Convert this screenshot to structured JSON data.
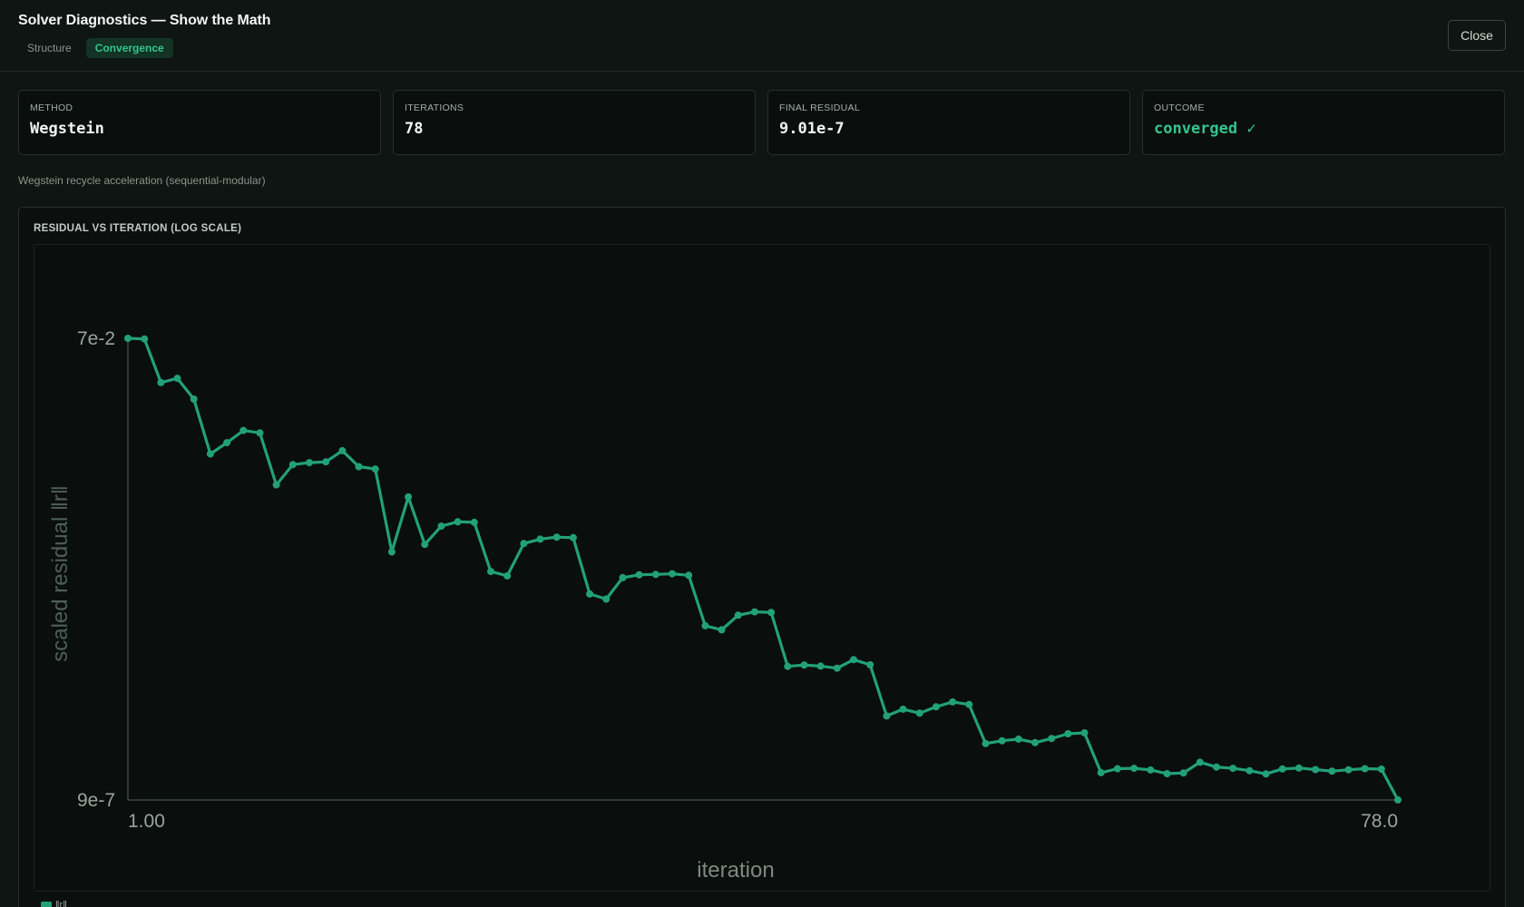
{
  "header": {
    "title": "Solver Diagnostics — Show the Math",
    "tabs": [
      {
        "label": "Structure",
        "active": false
      },
      {
        "label": "Convergence",
        "active": true
      }
    ],
    "close_label": "Close"
  },
  "stats": [
    {
      "label": "METHOD",
      "value": "Wegstein"
    },
    {
      "label": "ITERATIONS",
      "value": "78"
    },
    {
      "label": "FINAL RESIDUAL",
      "value": "9.01e-7"
    },
    {
      "label": "OUTCOME",
      "value": "converged ✓"
    }
  ],
  "description": "Wegstein recycle acceleration (sequential-modular)",
  "chart_panel": {
    "title": "RESIDUAL VS ITERATION (LOG SCALE)"
  },
  "colors": {
    "accent": "#22a178",
    "accent_text": "#34c48f",
    "background": "#0f1512",
    "panel": "#0a0f0d"
  },
  "chart_data": {
    "type": "line",
    "title": "",
    "xlabel": "iteration",
    "ylabel": "scaled residual ‖r‖",
    "y_scale": "log",
    "xlim": [
      1,
      78
    ],
    "ylim": [
      9e-07,
      0.07
    ],
    "x_tick_labels": [
      "1.00",
      "78.0"
    ],
    "y_tick_labels": [
      "7e-2",
      "9e-7"
    ],
    "legend": {
      "position": "bottom-left",
      "entries": [
        "‖r‖"
      ]
    },
    "series": [
      {
        "name": "‖r‖",
        "x": [
          1,
          2,
          3,
          4,
          5,
          6,
          7,
          8,
          9,
          10,
          11,
          12,
          13,
          14,
          15,
          16,
          17,
          18,
          19,
          20,
          21,
          22,
          23,
          24,
          25,
          26,
          27,
          28,
          29,
          30,
          31,
          32,
          33,
          34,
          35,
          36,
          37,
          38,
          39,
          40,
          41,
          42,
          43,
          44,
          45,
          46,
          47,
          48,
          49,
          50,
          51,
          52,
          53,
          54,
          55,
          56,
          57,
          58,
          59,
          60,
          61,
          62,
          63,
          64,
          65,
          66,
          67,
          68,
          69,
          70,
          71,
          72,
          73,
          74,
          75,
          76,
          77,
          78
        ],
        "values": [
          0.07,
          0.069,
          0.0238,
          0.0264,
          0.0159,
          0.00417,
          0.00549,
          0.0074,
          0.00697,
          0.00196,
          0.00322,
          0.00337,
          0.00344,
          0.00451,
          0.00306,
          0.00289,
          0.000382,
          0.00146,
          0.000459,
          0.000716,
          0.000796,
          0.000786,
          0.000237,
          0.000213,
          0.000468,
          0.000522,
          0.000548,
          0.000541,
          0.000137,
          0.000121,
          0.000204,
          0.000219,
          0.000221,
          0.000224,
          0.000216,
          6.31e-05,
          5.71e-05,
          8.15e-05,
          8.85e-05,
          8.73e-05,
          2.34e-05,
          2.42e-05,
          2.36e-05,
          2.24e-05,
          2.76e-05,
          2.43e-05,
          6.98e-06,
          8.24e-06,
          7.48e-06,
          8.74e-06,
          9.84e-06,
          9.24e-06,
          3.56e-06,
          3.82e-06,
          3.97e-06,
          3.64e-06,
          4.03e-06,
          4.53e-06,
          4.63e-06,
          1.75e-06,
          1.93e-06,
          1.95e-06,
          1.87e-06,
          1.71e-06,
          1.74e-06,
          2.26e-06,
          2.01e-06,
          1.95e-06,
          1.84e-06,
          1.7e-06,
          1.92e-06,
          1.96e-06,
          1.89e-06,
          1.82e-06,
          1.88e-06,
          1.93e-06,
          1.91e-06,
          9.01e-07
        ]
      }
    ]
  }
}
